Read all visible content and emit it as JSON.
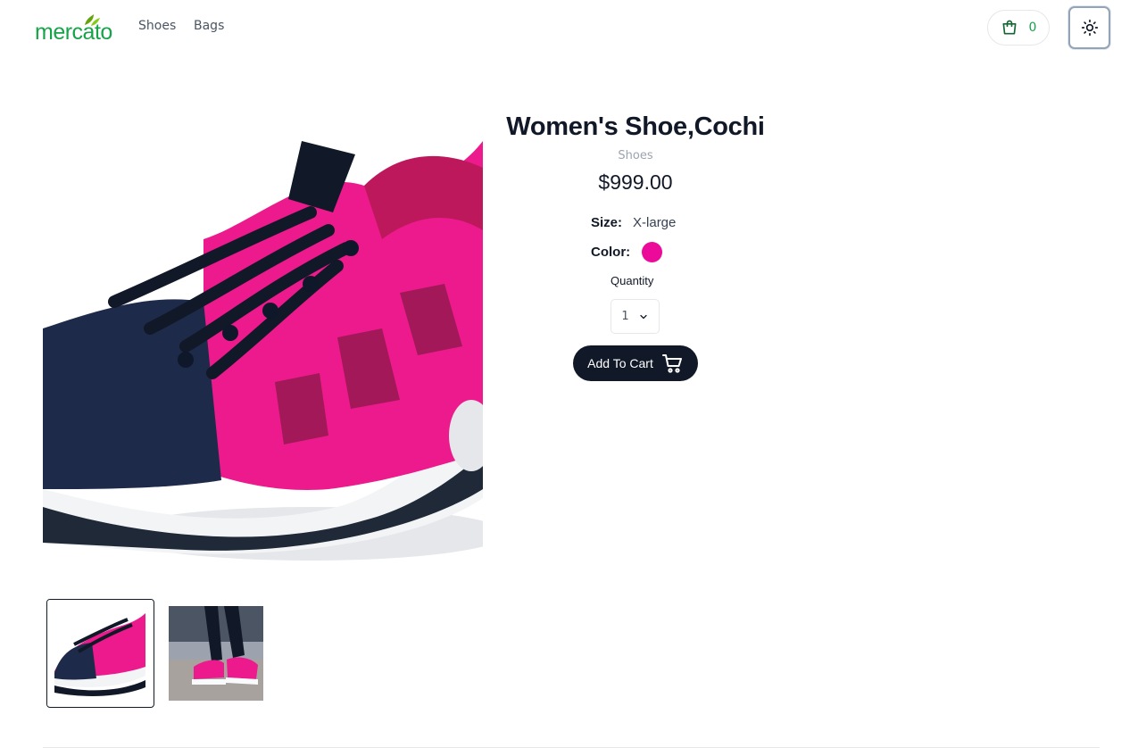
{
  "header": {
    "logo_text": "mercato",
    "nav": [
      {
        "label": "Shoes"
      },
      {
        "label": "Bags"
      }
    ],
    "cart_count": "0",
    "cart_icon": "shopping-bag-icon",
    "theme_icon": "sun-icon"
  },
  "product": {
    "title": "Women's Shoe,Cochi",
    "category": "Shoes",
    "price": "$999.00",
    "size_label": "Size:",
    "size_value": "X-large",
    "color_label": "Color:",
    "color_value": "#ec0a9b",
    "quantity_label": "Quantity",
    "quantity_value": "1",
    "add_to_cart_label": "Add To Cart",
    "add_to_cart_icon": "cart-icon"
  },
  "gallery": {
    "main_image": "pink-navy-sneaker-closeup",
    "thumbnails": [
      {
        "image": "pink-navy-sneaker-side",
        "selected": true
      },
      {
        "image": "sneaker-worn-on-feet",
        "selected": false
      }
    ]
  },
  "colors": {
    "brand": "#16a34a",
    "primary_dark": "#111827"
  }
}
